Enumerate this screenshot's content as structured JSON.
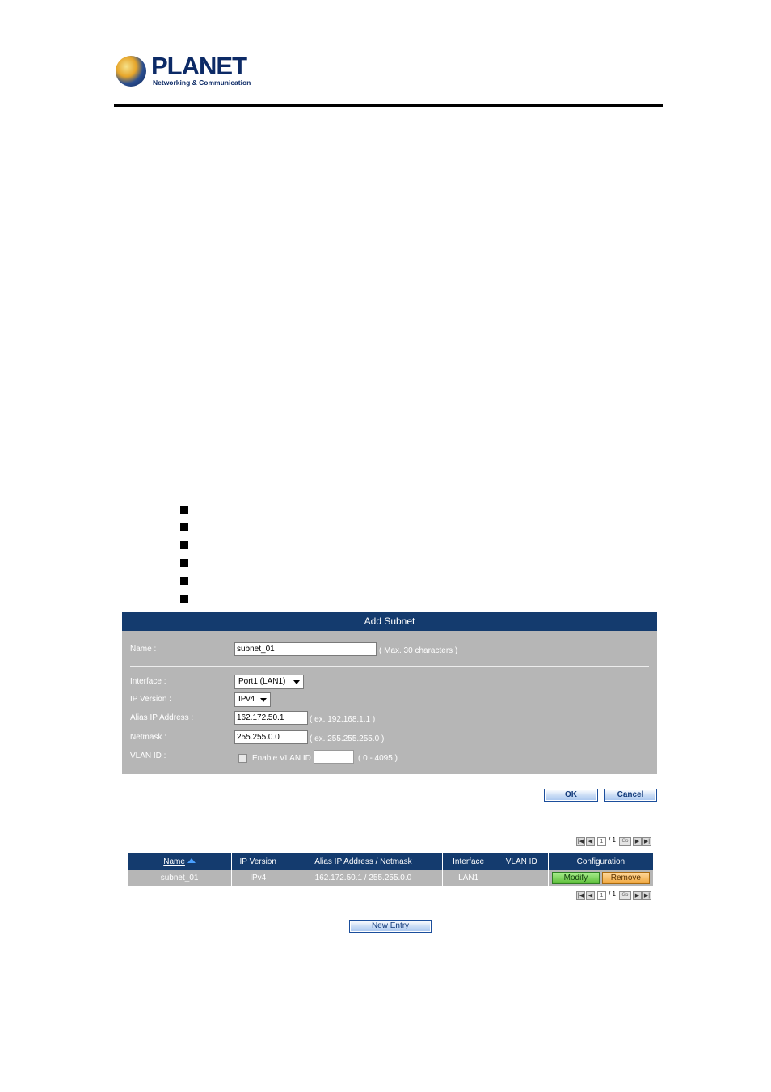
{
  "brand": {
    "name": "PLANET",
    "tagline": "Networking & Communication"
  },
  "form": {
    "title": "Add Subnet",
    "name_label": "Name :",
    "name_value": "subnet_01",
    "name_hint": "( Max. 30 characters )",
    "interface_label": "Interface :",
    "interface_value": "Port1 (LAN1)",
    "ip_version_label": "IP Version :",
    "ip_version_value": "IPv4",
    "alias_label": "Alias IP Address :",
    "alias_value": "162.172.50.1",
    "alias_hint": "( ex. 192.168.1.1 )",
    "netmask_label": "Netmask :",
    "netmask_value": "255.255.0.0",
    "netmask_hint": "( ex. 255.255.255.0 )",
    "vlan_label": "VLAN ID :",
    "vlan_checkbox_label": "Enable VLAN ID",
    "vlan_value": "",
    "vlan_hint": "( 0 - 4095 )",
    "vlan_enabled": false
  },
  "actions": {
    "ok_label": "OK",
    "cancel_label": "Cancel",
    "new_entry_label": "New Entry"
  },
  "pager": {
    "current_page": "1",
    "total_text": "/ 1",
    "go_label": "Go"
  },
  "table": {
    "headers": {
      "name": "Name",
      "ip_version": "IP Version",
      "alias": "Alias IP Address / Netmask",
      "interface": "Interface",
      "vlan_id": "VLAN ID",
      "configuration": "Configuration"
    },
    "rows": [
      {
        "name": "subnet_01",
        "ip_version": "IPv4",
        "alias": "162.172.50.1 / 255.255.0.0",
        "interface": "LAN1",
        "vlan_id": "",
        "modify_label": "Modify",
        "remove_label": "Remove"
      }
    ]
  },
  "colors": {
    "header_blue": "#143b6e",
    "panel_gray": "#b6b6b6",
    "modify_green": "#5fbf3b",
    "remove_orange": "#f0a840"
  }
}
